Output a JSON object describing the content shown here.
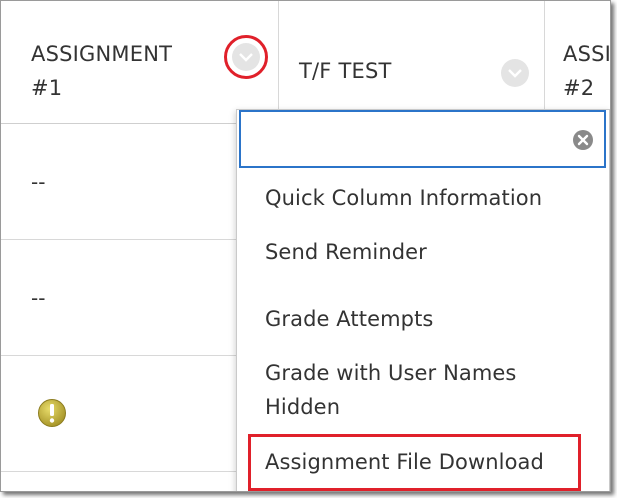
{
  "columns": [
    {
      "line1": "ASSIGNMENT",
      "line2": "#1"
    },
    {
      "line1": "T/F TEST",
      "line2": ""
    },
    {
      "line1": "ASSI",
      "line2": "#2"
    }
  ],
  "cells": {
    "row1": "--",
    "row2": "--"
  },
  "menu": {
    "search_value": "",
    "items": [
      {
        "label": "Quick Column Information"
      },
      {
        "label": "Send Reminder"
      },
      {
        "label": "Grade Attempts"
      },
      {
        "label": "Grade with User Names"
      },
      {
        "label": "Hidden"
      },
      {
        "label": "Assignment File Download"
      }
    ]
  },
  "colors": {
    "highlight": "#e0202a",
    "search_border": "#2b74c9",
    "warning": "#c9b32a"
  }
}
